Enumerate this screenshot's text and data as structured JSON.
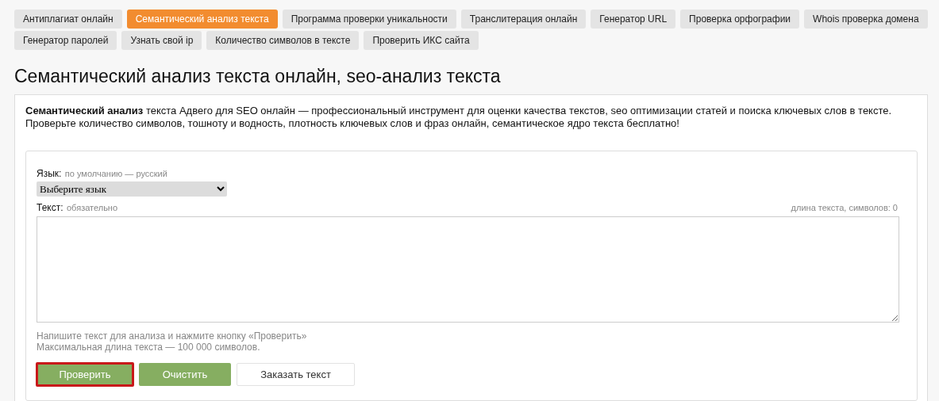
{
  "tabs": [
    {
      "label": "Антиплагиат онлайн",
      "selected": false
    },
    {
      "label": "Семантический анализ текста",
      "selected": true
    },
    {
      "label": "Программа проверки уникальности",
      "selected": false
    },
    {
      "label": "Транслитерация онлайн",
      "selected": false
    },
    {
      "label": "Генератор URL",
      "selected": false
    },
    {
      "label": "Проверка орфографии",
      "selected": false
    },
    {
      "label": "Whois проверка домена",
      "selected": false
    },
    {
      "label": "Генератор паролей",
      "selected": false
    },
    {
      "label": "Узнать свой ip",
      "selected": false
    },
    {
      "label": "Количество символов в тексте",
      "selected": false
    },
    {
      "label": "Проверить ИКС сайта",
      "selected": false
    }
  ],
  "page_title": "Семантический анализ текста онлайн, seo-анализ текста",
  "intro": "**Семантический анализ** текста Адвего для SEO онлайн — профессиональный инструмент для оценки качества текстов, seo оптимизации статей и поиска ключевых слов в тексте. Проверьте количество символов, тошноту и водность, плотность ключевых слов и фраз онлайн, семантическое ядро текста бесплатно!",
  "form": {
    "language": {
      "label": "Язык:",
      "hint": "по умолчанию — русский",
      "value": "Выберите язык"
    },
    "text": {
      "label": "Текст:",
      "hint": "обязательно",
      "counter": "длина текста, символов: 0"
    },
    "help": [
      "Напишите текст для анализа и нажмите кнопку «Проверить»",
      "Максимальная длина текста — 100 000 символов."
    ],
    "buttons": [
      {
        "label": "Проверить",
        "kind": "primary",
        "highlighted": true
      },
      {
        "label": "Очистить",
        "kind": "primary",
        "highlighted": false
      },
      {
        "label": "Заказать текст",
        "kind": "outline",
        "highlighted": false
      }
    ]
  }
}
